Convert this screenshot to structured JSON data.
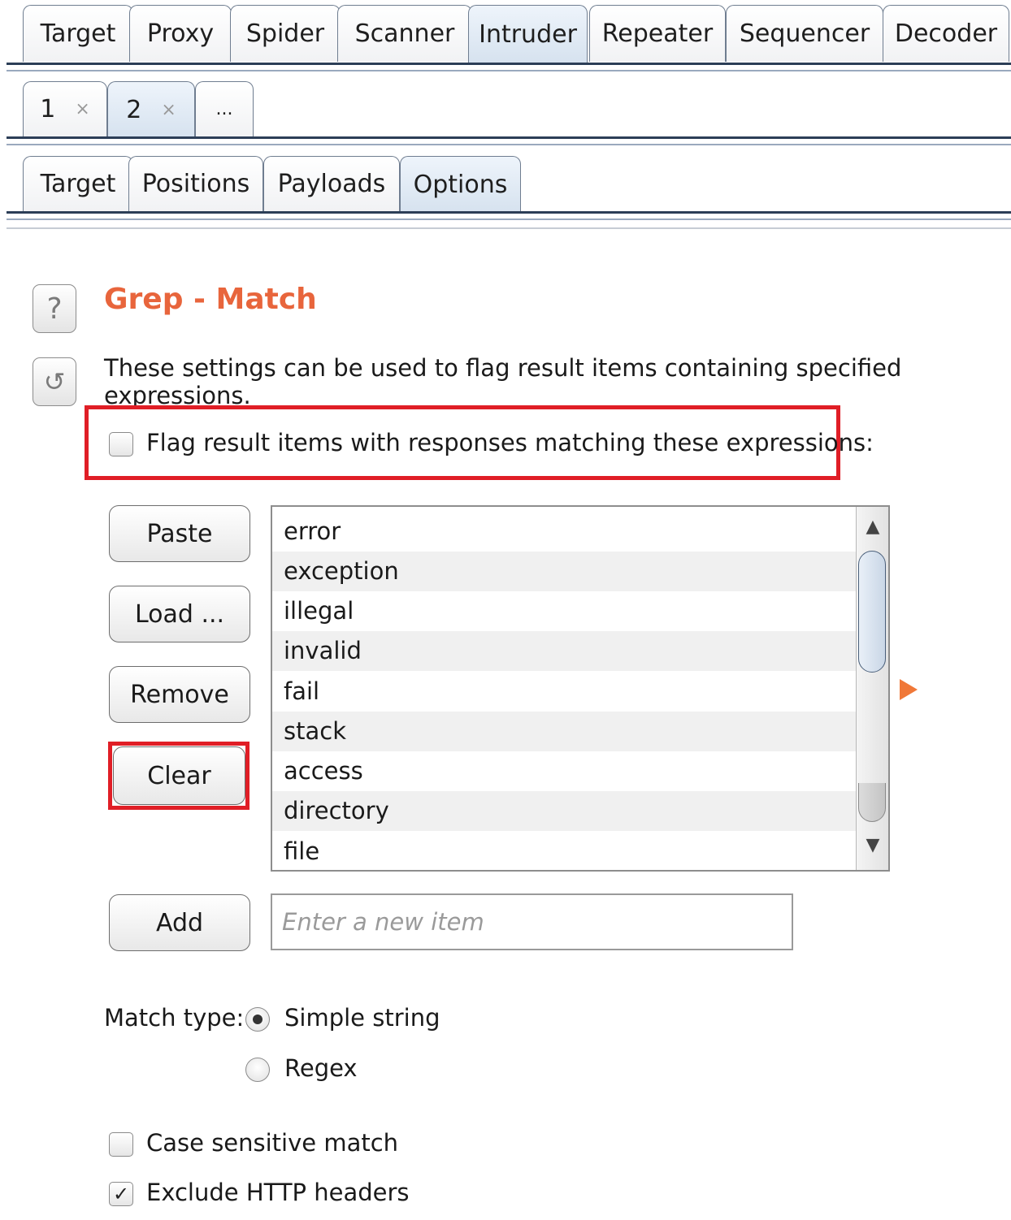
{
  "main_tabs": [
    {
      "label": "Target"
    },
    {
      "label": "Proxy"
    },
    {
      "label": "Spider"
    },
    {
      "label": "Scanner"
    },
    {
      "label": "Intruder"
    },
    {
      "label": "Repeater"
    },
    {
      "label": "Sequencer"
    },
    {
      "label": "Decoder"
    }
  ],
  "attack_tabs": [
    {
      "label": "1",
      "close": "×"
    },
    {
      "label": "2",
      "close": "×"
    },
    {
      "label": "..."
    }
  ],
  "sub_tabs": [
    {
      "label": "Target"
    },
    {
      "label": "Positions"
    },
    {
      "label": "Payloads"
    },
    {
      "label": "Options"
    }
  ],
  "active_main_tab": "Intruder",
  "active_sub_tab": "Options",
  "section": {
    "help_icon": "?",
    "reset_icon": "↺",
    "title": "Grep - Match",
    "description": "These settings can be used to flag result items containing specified expressions.",
    "flag_checkbox_label": "Flag result items with responses matching these expressions:",
    "flag_checked": false
  },
  "buttons": {
    "paste": "Paste",
    "load": "Load ...",
    "remove": "Remove",
    "clear": "Clear",
    "add": "Add"
  },
  "expressions": [
    "error",
    "exception",
    "illegal",
    "invalid",
    "fail",
    "stack",
    "access",
    "directory",
    "file"
  ],
  "new_item": {
    "value": "",
    "placeholder": "Enter a new item"
  },
  "match_type": {
    "label": "Match type:",
    "options": [
      "Simple string",
      "Regex"
    ],
    "selected": "Simple string"
  },
  "options": {
    "case_sensitive": {
      "label": "Case sensitive match",
      "checked": false,
      "mark": ""
    },
    "exclude_headers": {
      "label": "Exclude HTTP headers",
      "checked": true,
      "mark": "✓"
    }
  },
  "colors": {
    "accent_title": "#e8653c",
    "highlight_red": "#e01e26",
    "tab_border_dark": "#2c3e57"
  }
}
